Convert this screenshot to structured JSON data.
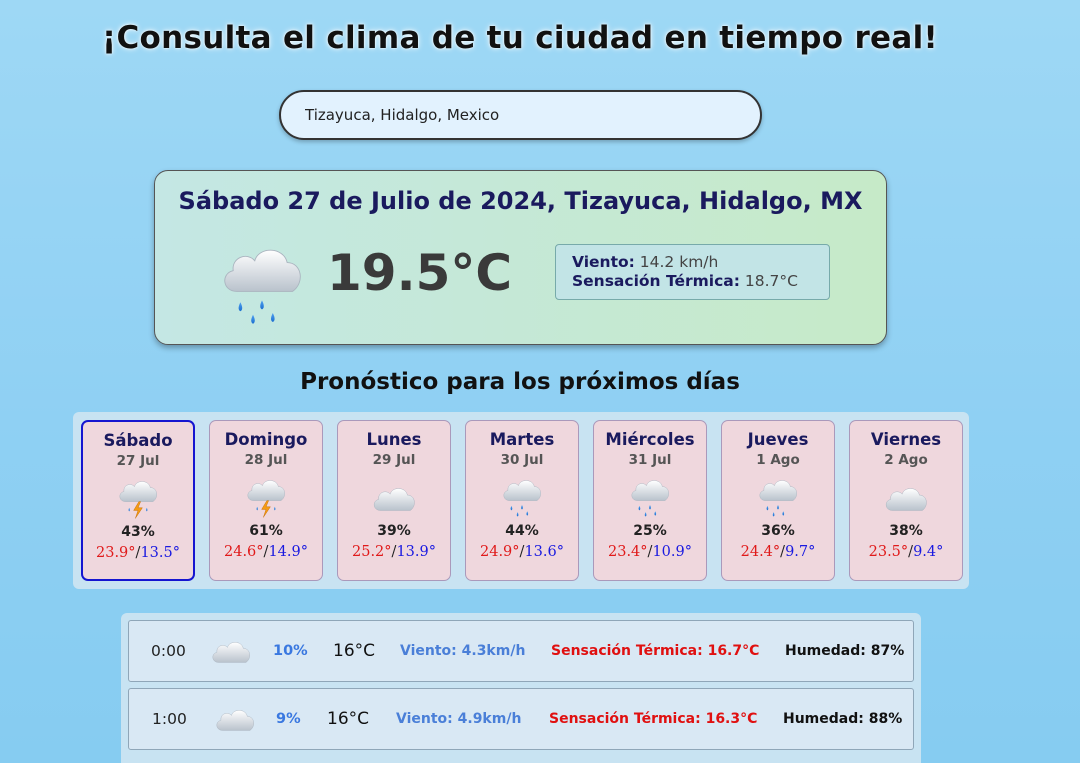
{
  "header": {
    "title": "¡Consulta el clima de tu ciudad en tiempo real!"
  },
  "search": {
    "value": "Tizayuca, Hidalgo, Mexico"
  },
  "current": {
    "date_location": "Sábado 27 de Julio de 2024, Tizayuca, Hidalgo, MX",
    "icon": "rain-cloud-icon",
    "temperature": "19.5°C",
    "wind_label": "Viento:",
    "wind_value": "14.2 km/h",
    "feels_label": "Sensación Térmica:",
    "feels_value": "18.7°C"
  },
  "forecast": {
    "title": "Pronóstico para los próximos días",
    "days": [
      {
        "name": "Sábado",
        "date": "27 Jul",
        "icon": "thunderstorm-icon",
        "prob": "43%",
        "max": "23.9°",
        "min": "13.5°"
      },
      {
        "name": "Domingo",
        "date": "28 Jul",
        "icon": "thunderstorm-icon",
        "prob": "61%",
        "max": "24.6°",
        "min": "14.9°"
      },
      {
        "name": "Lunes",
        "date": "29 Jul",
        "icon": "cloud-icon",
        "prob": "39%",
        "max": "25.2°",
        "min": "13.9°"
      },
      {
        "name": "Martes",
        "date": "30 Jul",
        "icon": "rain-cloud-icon",
        "prob": "44%",
        "max": "24.9°",
        "min": "13.6°"
      },
      {
        "name": "Miércoles",
        "date": "31 Jul",
        "icon": "rain-cloud-icon",
        "prob": "25%",
        "max": "23.4°",
        "min": "10.9°"
      },
      {
        "name": "Jueves",
        "date": "1 Ago",
        "icon": "rain-cloud-icon",
        "prob": "36%",
        "max": "24.4°",
        "min": "9.7°"
      },
      {
        "name": "Viernes",
        "date": "2 Ago",
        "icon": "cloud-icon",
        "prob": "38%",
        "max": "23.5°",
        "min": "9.4°"
      }
    ]
  },
  "hourly": [
    {
      "time": "0:00",
      "icon": "cloud-icon",
      "prob": "10%",
      "temp": "16°C",
      "wind": "Viento: 4.3km/h",
      "feels": "Sensación Térmica: 16.7°C",
      "humidity": "Humedad: 87%"
    },
    {
      "time": "1:00",
      "icon": "cloud-icon",
      "prob": "9%",
      "temp": "16°C",
      "wind": "Viento: 4.9km/h",
      "feels": "Sensación Térmica: 16.3°C",
      "humidity": "Humedad: 88%"
    }
  ],
  "colors": {
    "max_temp": "#e01a1a",
    "min_temp": "#1a1ae0",
    "active_border": "#1515d0"
  }
}
